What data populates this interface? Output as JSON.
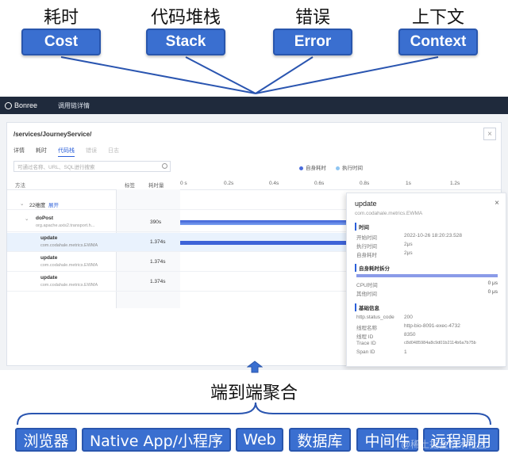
{
  "top": {
    "concepts": [
      {
        "cn": "耗时",
        "en": "Cost"
      },
      {
        "cn": "代码堆栈",
        "en": "Stack"
      },
      {
        "cn": "错误",
        "en": "Error"
      },
      {
        "cn": "上下文",
        "en": "Context"
      }
    ]
  },
  "app": {
    "brand": "Bonree",
    "nav_title": "调用链详情",
    "path": "/services/JourneyService/",
    "close": "×",
    "tabs": [
      "详情",
      "耗时",
      "代码栈",
      "错误",
      "日志"
    ],
    "search_placeholder": "可通过名称、URL、SQL进行搜索",
    "legend": [
      {
        "label": "自身耗时",
        "color": "#4a6cdc"
      },
      {
        "label": "执行时间",
        "color": "#8ec5f2"
      }
    ],
    "columns": {
      "method": "方法",
      "tag": "标签",
      "timing": "耗时量",
      "ticks": [
        "0 s",
        "0.2s",
        "0.4s",
        "0.6s",
        "0.8s",
        "1s",
        "1.2s"
      ]
    },
    "group_row": {
      "label": "22维度",
      "link": "展开"
    },
    "rows": [
      {
        "name": "doPost",
        "sub": "org.apache.axis2.transport.h...",
        "value": "390s",
        "selected": false
      },
      {
        "name": "update",
        "sub": "com.codahale.metrics.EWMA",
        "value": "1.374s",
        "selected": true
      },
      {
        "name": "update",
        "sub": "com.codahale.metrics.EWMA",
        "value": "1.374s",
        "selected": false
      },
      {
        "name": "update",
        "sub": "com.codahale.metrics.EWMA",
        "value": "1.374s",
        "selected": false
      }
    ],
    "detail": {
      "title": "update",
      "subtitle": "com.codahale.metrics.EWMA",
      "close": "×",
      "time_section": "时间",
      "time_rows": [
        {
          "k": "开始时间",
          "v": "2022-10-26 18:20:23.528"
        },
        {
          "k": "执行时间",
          "v": "2μs"
        },
        {
          "k": "自身耗时",
          "v": "2μs"
        }
      ],
      "self_section": "自身耗时拆分",
      "cpu_label": "CPU时间",
      "cpu_value": "0 μs",
      "other_label": "其他时间",
      "other_value": "0 μs",
      "basic_section": "基础信息",
      "basic_rows": [
        {
          "k": "http.status_code",
          "v": "200"
        },
        {
          "k": "线程名称",
          "v": "http-bio-8091-exec-4732"
        },
        {
          "k": "线程 ID",
          "v": "8350"
        },
        {
          "k": "Trace ID",
          "v": "c8d0485984a8c9d01b2114b6a7b75b"
        },
        {
          "k": "Span ID",
          "v": "1"
        }
      ]
    }
  },
  "aggregate_label": "端到端聚合",
  "sources": [
    "浏览器",
    "Native App/小程序",
    "Web",
    "数据库",
    "中间件",
    "远程调用"
  ],
  "watermark": "@稀土掘金技术社区",
  "colors": {
    "accent": "#3a6fd0",
    "header": "#1f2a3c",
    "bar": "#3d63d8"
  }
}
